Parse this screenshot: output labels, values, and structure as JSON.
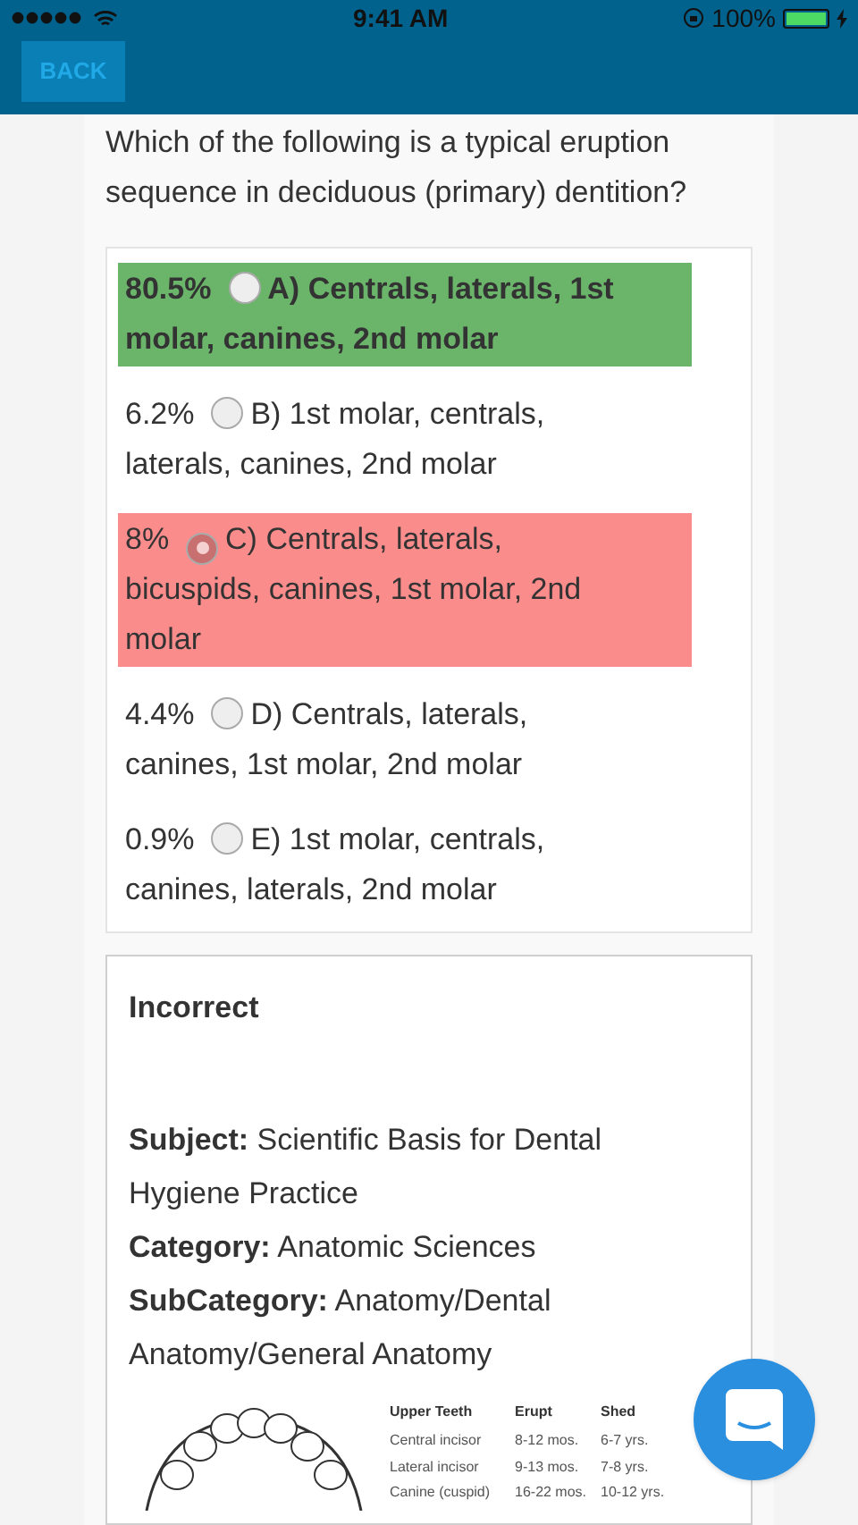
{
  "status_bar": {
    "time": "9:41 AM",
    "battery": "100%"
  },
  "nav": {
    "back": "BACK"
  },
  "question": "Which of the following is a typical eruption sequence in deciduous (primary) dentition?",
  "options": [
    {
      "percent": "80.5%",
      "label": "A) Centrals, laterals, 1st molar, canines, 2nd molar",
      "kind": "correct",
      "selected": false
    },
    {
      "percent": "6.2%",
      "label": "B) 1st molar, centrals, laterals, canines, 2nd molar",
      "kind": "none",
      "selected": false
    },
    {
      "percent": "8%",
      "label": "C) Centrals, laterals, bicuspids, canines, 1st molar, 2nd molar",
      "kind": "incorrect",
      "selected": true
    },
    {
      "percent": "4.4%",
      "label": "D) Centrals, laterals, canines, 1st molar, 2nd molar",
      "kind": "none",
      "selected": false
    },
    {
      "percent": "0.9%",
      "label": "E) 1st molar, centrals, canines, laterals, 2nd molar",
      "kind": "none",
      "selected": false
    }
  ],
  "explanation": {
    "title": "Incorrect",
    "fields": [
      {
        "label": "Subject:",
        "value": "Scientific Basis for Dental Hygiene Practice"
      },
      {
        "label": "Category:",
        "value": "Anatomic Sciences"
      },
      {
        "label": "SubCategory:",
        "value": "Anatomy/Dental Anatomy/General Anatomy"
      }
    ],
    "figure": {
      "columns": [
        "Upper Teeth",
        "Erupt",
        "Shed"
      ],
      "rows": [
        [
          "Central incisor",
          "8-12 mos.",
          "6-7 yrs."
        ],
        [
          "Lateral incisor",
          "9-13 mos.",
          "7-8 yrs."
        ],
        [
          "Canine (cuspid)",
          "16-22 mos.",
          "10-12 yrs."
        ]
      ]
    }
  }
}
